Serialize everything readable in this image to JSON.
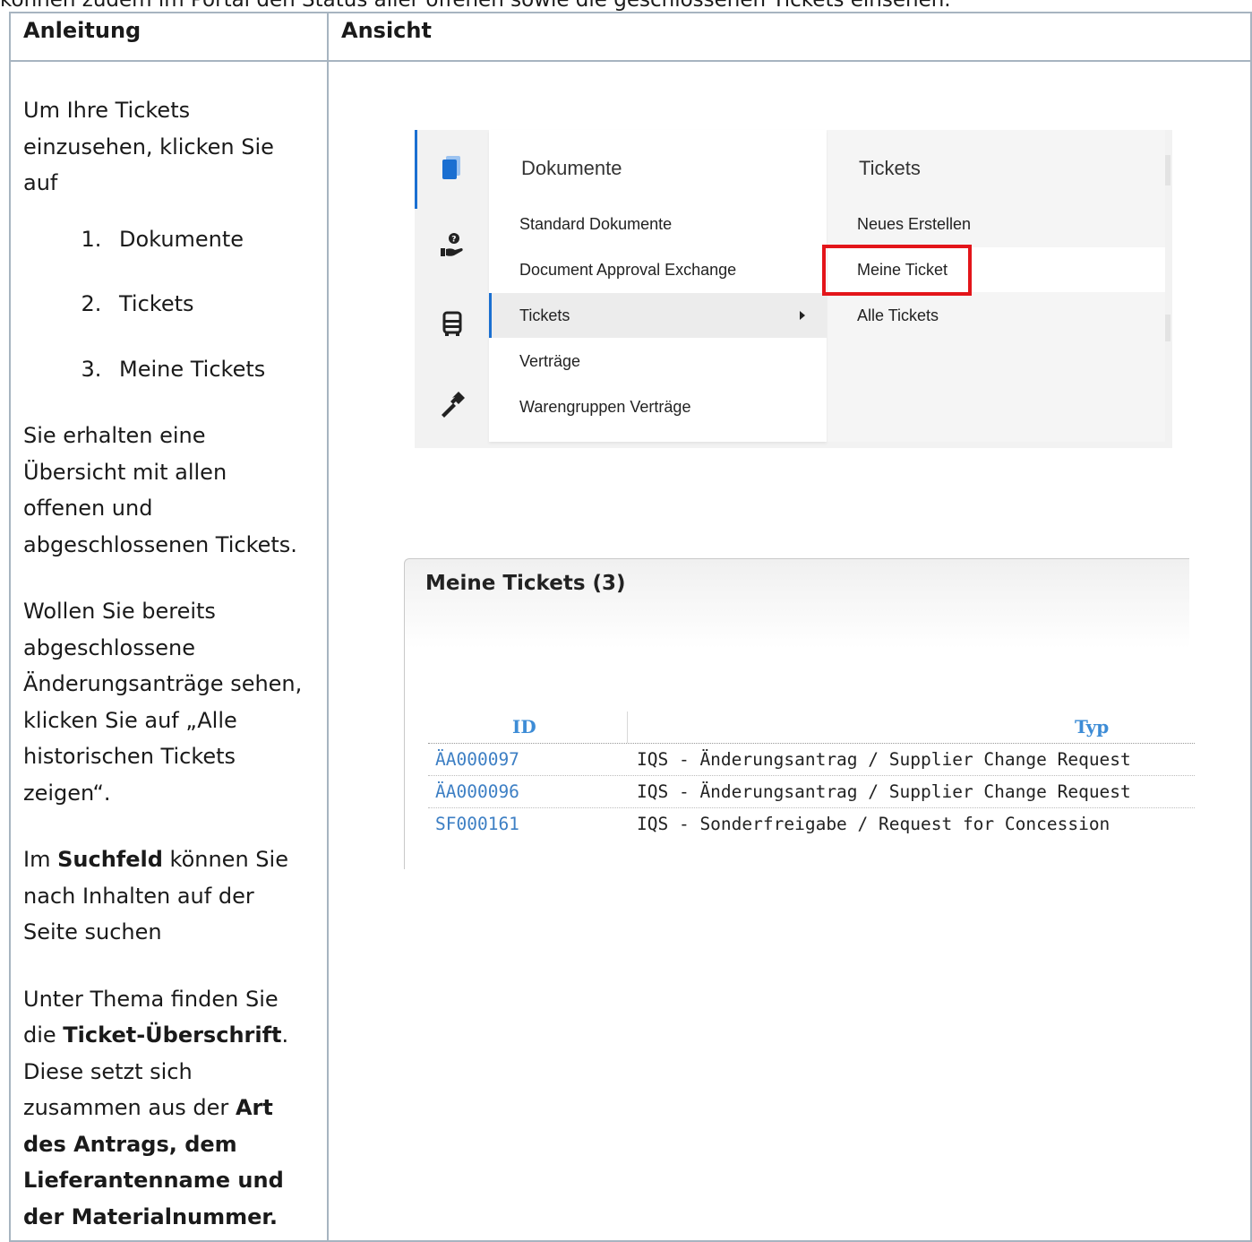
{
  "intro": "können zudem im Portal den Status aller offenen sowie die geschlossenen Tickets einsehen.",
  "table": {
    "col_left_header": "Anleitung",
    "col_right_header": "Ansicht"
  },
  "instructions": {
    "p1": "Um Ihre Tickets einzusehen, klicken Sie auf",
    "steps": [
      "Dokumente",
      "Tickets",
      "Meine Tickets"
    ],
    "p2": "Sie erhalten eine Übersicht mit allen offenen und abgeschlossenen Tickets.",
    "p3": "Wollen Sie bereits abgeschlossene Änderungsanträge sehen, klicken Sie auf „Alle historischen Tickets zeigen“.",
    "p4_pre": "Im ",
    "p4_bold": "Suchfeld",
    "p4_post": " können Sie nach Inhalten auf der Seite suchen",
    "p5_pre": "Unter Thema finden Sie die ",
    "p5_bold1": "Ticket-Überschrift",
    "p5_mid": ". Diese setzt sich zusammen aus der ",
    "p5_bold2": "Art des Antrags, dem Lieferantenname und der Materialnummer."
  },
  "menu": {
    "col1_header": "Dokumente",
    "col1_items": [
      "Standard Dokumente",
      "Document Approval Exchange",
      "Tickets",
      "Verträge",
      "Warengruppen Verträge"
    ],
    "col2_header": "Tickets",
    "col2_items": [
      "Neues Erstellen",
      "Meine Ticket",
      "Alle Tickets"
    ],
    "rail_icons": [
      "documents-icon",
      "support-hand-icon",
      "truck-icon",
      "tools-icon"
    ],
    "accent": "#1a6fd1",
    "highlight_color": "#e3151a"
  },
  "tickets": {
    "title": "Meine Tickets (3)",
    "headers": [
      "ID",
      "Typ"
    ],
    "rows": [
      {
        "id": "ÄA000097",
        "typ": "IQS - Änderungsantrag / Supplier Change Request"
      },
      {
        "id": "ÄA000096",
        "typ": "IQS - Änderungsantrag / Supplier Change Request"
      },
      {
        "id": "SF000161",
        "typ": "IQS - Sonderfreigabe / Request for Concession"
      }
    ],
    "link_color": "#3d7fc4"
  }
}
